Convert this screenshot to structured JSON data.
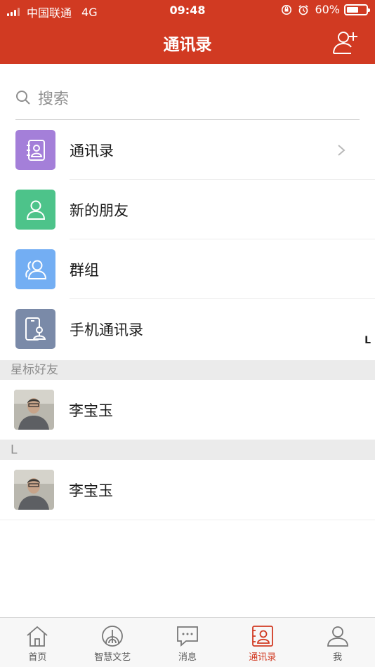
{
  "status_bar": {
    "carrier": "中国联通",
    "network": "4G",
    "time": "09:48",
    "battery": "60%",
    "battery_level": 0.6
  },
  "header": {
    "title": "通讯录",
    "add_icon": "add-contact-icon"
  },
  "search": {
    "placeholder": "搜索"
  },
  "menu": [
    {
      "label": "通讯录",
      "icon": "contact-book-icon",
      "color": "#a47fd9"
    },
    {
      "label": "新的朋友",
      "icon": "new-friend-icon",
      "color": "#4dc38a"
    },
    {
      "label": "群组",
      "icon": "group-icon",
      "color": "#73aef3"
    },
    {
      "label": "手机通讯录",
      "icon": "phone-contacts-icon",
      "color": "#7a8aa8"
    }
  ],
  "index_letter": "L",
  "sections": [
    {
      "title": "星标好友",
      "contacts": [
        {
          "name": "李宝玉"
        }
      ]
    },
    {
      "title": "L",
      "contacts": [
        {
          "name": "李宝玉"
        }
      ]
    }
  ],
  "tabs": [
    {
      "label": "首页",
      "icon": "home-icon",
      "active": false
    },
    {
      "label": "智慧文艺",
      "icon": "culture-icon",
      "active": false
    },
    {
      "label": "消息",
      "icon": "message-icon",
      "active": false
    },
    {
      "label": "通讯录",
      "icon": "contacts-tab-icon",
      "active": true
    },
    {
      "label": "我",
      "icon": "profile-icon",
      "active": false
    }
  ],
  "colors": {
    "brand": "#d13a22",
    "section_bg": "#ebebeb"
  }
}
